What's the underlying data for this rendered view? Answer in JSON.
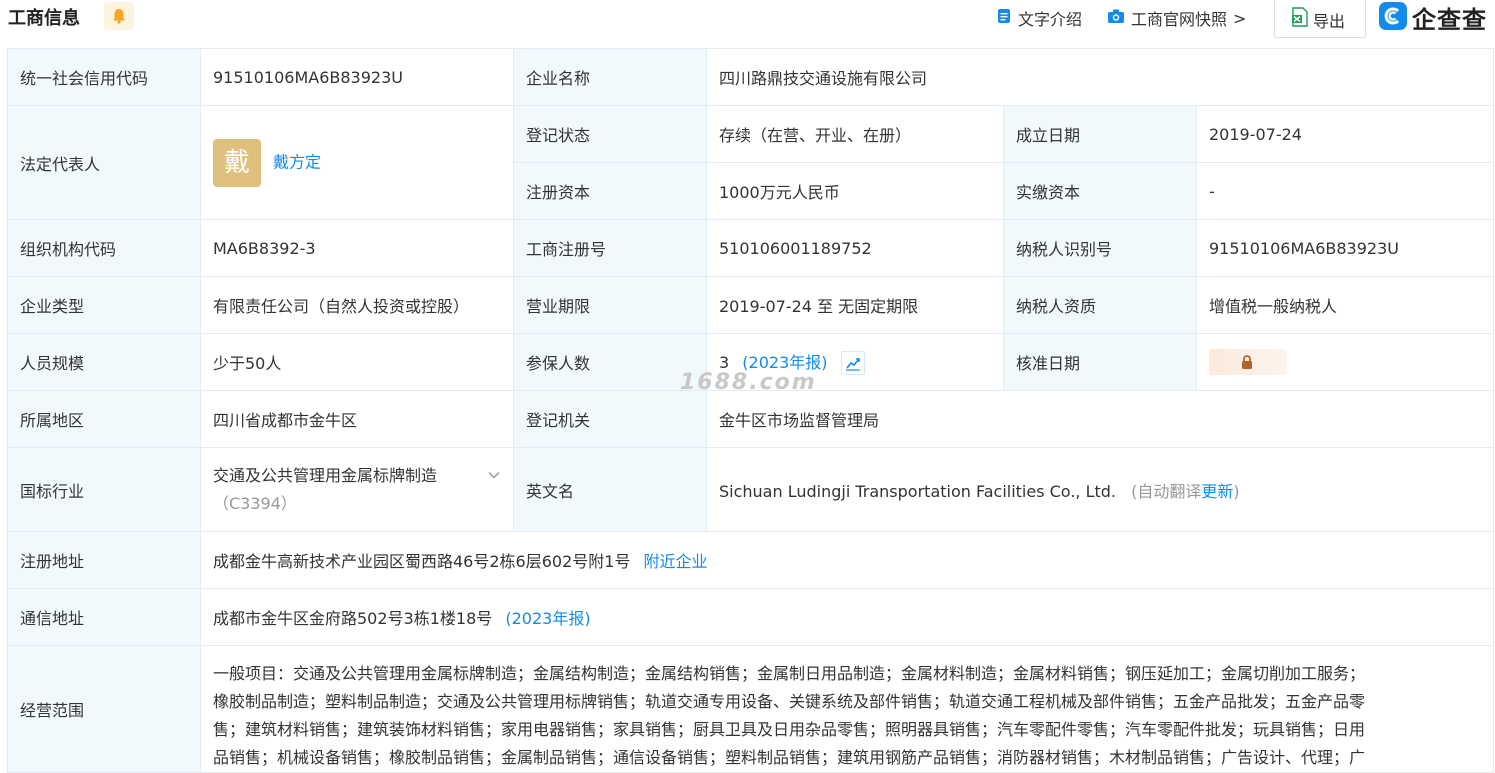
{
  "header": {
    "title": "工商信息",
    "text_intro": "文字介绍",
    "snapshot": "工商官网快照",
    "snapshot_chevron": ">",
    "export": "导出",
    "logo_text": "企查查"
  },
  "watermark": "1688.com",
  "rows": {
    "credit_code": {
      "label": "统一社会信用代码",
      "value": "91510106MA6B83923U"
    },
    "company_name": {
      "label": "企业名称",
      "value": "四川路鼎技交通设施有限公司"
    },
    "legal_rep": {
      "label": "法定代表人",
      "avatar": "戴",
      "value": "戴方定"
    },
    "reg_status": {
      "label": "登记状态",
      "value": "存续（在营、开业、在册）"
    },
    "found_date": {
      "label": "成立日期",
      "value": "2019-07-24"
    },
    "reg_capital": {
      "label": "注册资本",
      "value": "1000万元人民币"
    },
    "paid_capital": {
      "label": "实缴资本",
      "value": "-"
    },
    "org_code": {
      "label": "组织机构代码",
      "value": "MA6B8392-3"
    },
    "biz_reg_no": {
      "label": "工商注册号",
      "value": "510106001189752"
    },
    "taxpayer_id": {
      "label": "纳税人识别号",
      "value": "91510106MA6B83923U"
    },
    "company_type": {
      "label": "企业类型",
      "value": "有限责任公司（自然人投资或控股）"
    },
    "biz_term": {
      "label": "营业期限",
      "value": "2019-07-24 至 无固定期限"
    },
    "taxpayer_qual": {
      "label": "纳税人资质",
      "value": "增值税一般纳税人"
    },
    "staff_size": {
      "label": "人员规模",
      "value": "少于50人"
    },
    "insured": {
      "label": "参保人数",
      "value": "3",
      "report": "(2023年报)"
    },
    "approve_date": {
      "label": "核准日期"
    },
    "region": {
      "label": "所属地区",
      "value": "四川省成都市金牛区"
    },
    "reg_authority": {
      "label": "登记机关",
      "value": "金牛区市场监督管理局"
    },
    "industry": {
      "label": "国标行业",
      "value": "交通及公共管理用金属标牌制造",
      "code": "（C3394）"
    },
    "english_name": {
      "label": "英文名",
      "value": "Sichuan Ludingji Transportation Facilities Co., Ltd.",
      "auto_translate": "(自动翻译",
      "update": "更新",
      "close_paren": ")"
    },
    "reg_address": {
      "label": "注册地址",
      "value": "成都金牛高新技术产业园区蜀西路46号2栋6层602号附1号",
      "nearby": "附近企业"
    },
    "mail_address": {
      "label": "通信地址",
      "value": "成都市金牛区金府路502号3栋1楼18号",
      "report": "(2023年报)"
    },
    "scope": {
      "label": "经营范围",
      "lines": [
        "一般项目：交通及公共管理用金属标牌制造；金属结构制造；金属结构销售；金属制日用品制造；金属材料制造；金属材料销售；钢压延加工；金属切削加工服务；",
        "橡胶制品制造；塑料制品制造；交通及公共管理用标牌销售；轨道交通专用设备、关键系统及部件销售；轨道交通工程机械及部件销售；五金产品批发；五金产品零",
        "售；建筑材料销售；建筑装饰材料销售；家用电器销售；家具销售；厨具卫具及日用杂品零售；照明器具销售；汽车零配件零售；汽车零配件批发；玩具销售；日用",
        "品销售；机械设备销售；橡胶制品销售；金属制品销售；通信设备销售；塑料制品销售；建筑用钢筋产品销售；消防器材销售；木材制品销售；广告设计、代理；广"
      ]
    }
  }
}
